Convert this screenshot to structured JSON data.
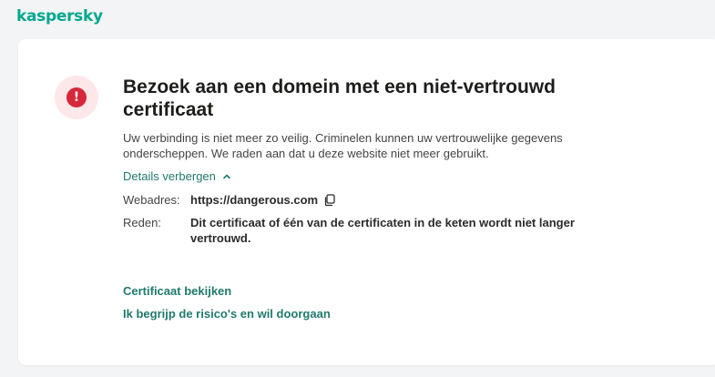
{
  "brand": {
    "logo_text": "kaspersky",
    "accent": "#00a88e"
  },
  "alert": {
    "icon": "exclamation-icon",
    "title": "Bezoek aan een domein met een niet-vertrouwd certificaat",
    "description": "Uw verbinding is niet meer zo veilig. Criminelen kunnen uw vertrouwelijke gegevens onderscheppen. We raden aan dat u deze website niet meer gebruikt.",
    "details_toggle": "Details verbergen",
    "details": {
      "url_label": "Webadres:",
      "url_value": "https://dangerous.com",
      "reason_label": "Reden:",
      "reason_value": "Dit certificaat of één van de certificaten in de keten wordt niet langer vertrouwd."
    }
  },
  "actions": {
    "view_certificate": "Certificaat bekijken",
    "accept_risk": "Ik begrijp de risico's en wil doorgaan"
  }
}
